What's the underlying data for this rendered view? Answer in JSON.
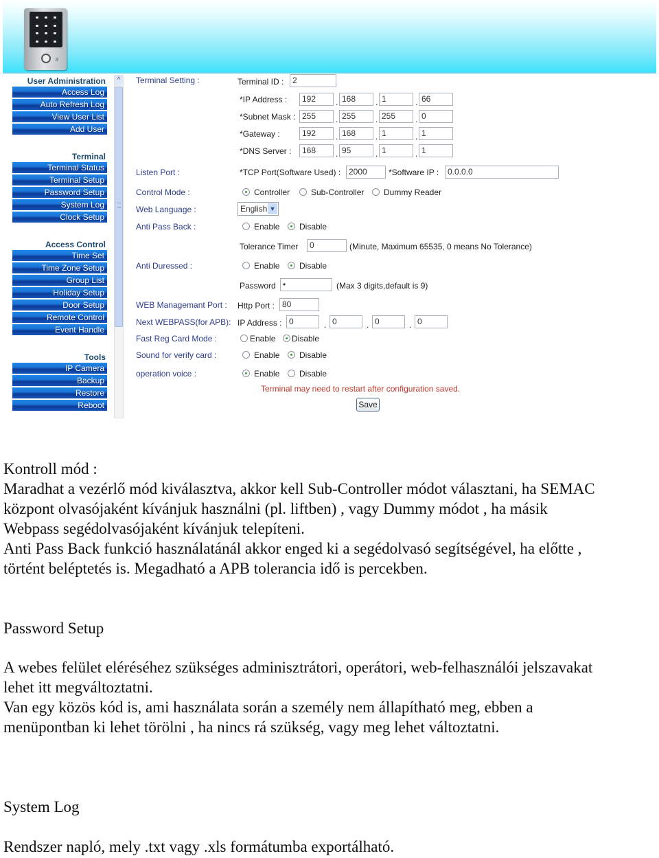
{
  "sidebar": {
    "groups": [
      {
        "title": "User Administration",
        "items": [
          "Access Log",
          "Auto Refresh Log",
          "View User List",
          "Add User"
        ]
      },
      {
        "title": "Terminal",
        "items": [
          "Terminal Status",
          "Terminal Setup",
          "Password Setup",
          "System Log",
          "Clock Setup"
        ]
      },
      {
        "title": "Access Control",
        "items": [
          "Time Set",
          "Time Zone Setup",
          "Group List",
          "Holiday Setup",
          "Door Setup",
          "Remote Control",
          "Event Handle"
        ]
      },
      {
        "title": "Tools",
        "items": [
          "IP Camera",
          "Backup",
          "Restore",
          "Reboot"
        ]
      }
    ],
    "scroll_up_icon": "^"
  },
  "form": {
    "terminal_setting_label": "Terminal Setting :",
    "terminal_id_label": "Terminal ID :",
    "terminal_id_value": "2",
    "ip_address_label": "*IP Address :",
    "ip_address": [
      "192",
      "168",
      "1",
      "66"
    ],
    "subnet_mask_label": "*Subnet Mask :",
    "subnet_mask": [
      "255",
      "255",
      "255",
      "0"
    ],
    "gateway_label": "*Gateway :",
    "gateway": [
      "192",
      "168",
      "1",
      "1"
    ],
    "dns_label": "*DNS Server :",
    "dns": [
      "168",
      "95",
      "1",
      "1"
    ],
    "listen_port_label": "Listen Port :",
    "tcp_port_label": "*TCP Port(Software Used) :",
    "tcp_port_value": "2000",
    "software_ip_label": "*Software IP :",
    "software_ip_value": "0.0.0.0",
    "control_mode_label": "Control Mode :",
    "control_mode_options": [
      "Controller",
      "Sub-Controller",
      "Dummy Reader"
    ],
    "control_mode_selected": "Controller",
    "web_language_label": "Web Language :",
    "web_language_value": "English",
    "anti_pass_back_label": "Anti Pass Back :",
    "anti_pass_back_selected": "Disable",
    "enable_label": "Enable",
    "disable_label": "Disable",
    "tolerance_timer_label": "Tolerance Timer",
    "tolerance_timer_value": "0",
    "tolerance_hint": "(Minute, Maximum 65535, 0 means No Tolerance)",
    "anti_duressed_label": "Anti Duressed :",
    "anti_duressed_selected": "Disable",
    "password_label": "Password",
    "password_value": "•",
    "password_hint": "(Max 3 digits,default is 9)",
    "web_port_label": "WEB Managemant Port :",
    "http_port_label": "Http Port :",
    "http_port_value": "80",
    "next_webpass_label": "Next WEBPASS(for APB):",
    "next_ip_label": "IP Address :",
    "next_ip": [
      "0",
      "0",
      "0",
      "0"
    ],
    "fast_reg_label": "Fast Reg Card Mode :",
    "fast_reg_selected": "Disable",
    "sound_label": "Sound for verify card :",
    "sound_selected": "Disable",
    "voice_label": "operation voice :",
    "voice_selected": "Enable",
    "warning": "Terminal may need to restart after configuration saved.",
    "save_label": "Save",
    "dot": "."
  },
  "doc": {
    "lines1": [
      "Kontroll mód :",
      "Maradhat a vezérlő mód kiválasztva, akkor kell Sub-Controller módot választani, ha SEMAC",
      "központ olvasójaként kívánjuk használni (pl. liftben) , vagy Dummy módot , ha másik",
      "Webpass segédolvasójaként kívánjuk telepíteni.",
      "Anti Pass Back funkció használatánál akkor enged ki a segédolvasó segítségével, ha előtte ,",
      "történt beléptetés is. Megadható a APB tolerancia  idő is   percekben."
    ],
    "password_setup_heading": "Password Setup",
    "lines2": [
      "A webes felület eléréséhez szükséges adminisztrátori, operátori, web-felhasználói jelszavakat",
      "lehet itt megváltoztatni.",
      "Van egy közös kód is, ami használata során a személy nem állapítható meg, ebben a",
      "menüpontban ki lehet törölni , ha nincs rá szükség, vagy meg lehet változtatni."
    ],
    "system_log_heading": "System Log",
    "system_log_text": "Rendszer napló, mely .txt vagy .xls formátumba exportálható."
  }
}
